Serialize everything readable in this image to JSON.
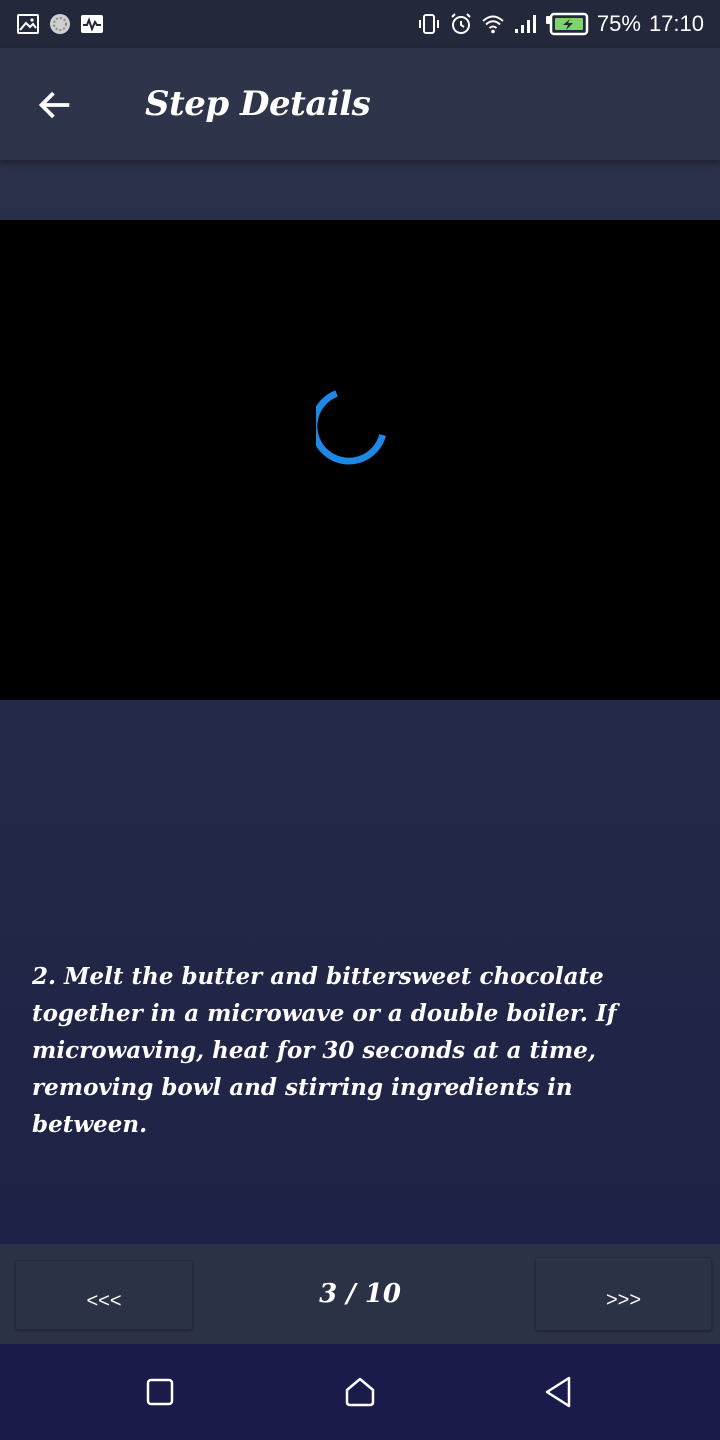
{
  "status_bar": {
    "left_icons": [
      "gallery-icon",
      "app-icon",
      "activity-icon"
    ],
    "right_icons": [
      "vibrate-icon",
      "alarm-icon",
      "wifi-icon",
      "signal-icon",
      "battery-charging-icon"
    ],
    "battery_percent": "75%",
    "time": "17:10"
  },
  "app_bar": {
    "back_icon": "arrow-left-icon",
    "title": "Step Details"
  },
  "video": {
    "state": "loading",
    "spinner_color": "#1e88e5"
  },
  "step": {
    "description": " 2. Melt the butter and bittersweet chocolate together in a microwave or a double boiler. If microwaving, heat for 30 seconds at a time, removing bowl and stirring ingredients in between."
  },
  "navigation": {
    "prev_label": "<<<",
    "counter": "3 / 10",
    "next_label": ">>>"
  },
  "system_nav": {
    "recents_icon": "square-icon",
    "home_icon": "home-icon",
    "back_icon": "triangle-back-icon"
  },
  "colors": {
    "status_bar": "#23283a",
    "app_bar": "#2e3449",
    "background": "#1f2446",
    "nav_bar": "#2c3245",
    "system_nav": "#1b1b4b",
    "text": "#ffffff"
  }
}
